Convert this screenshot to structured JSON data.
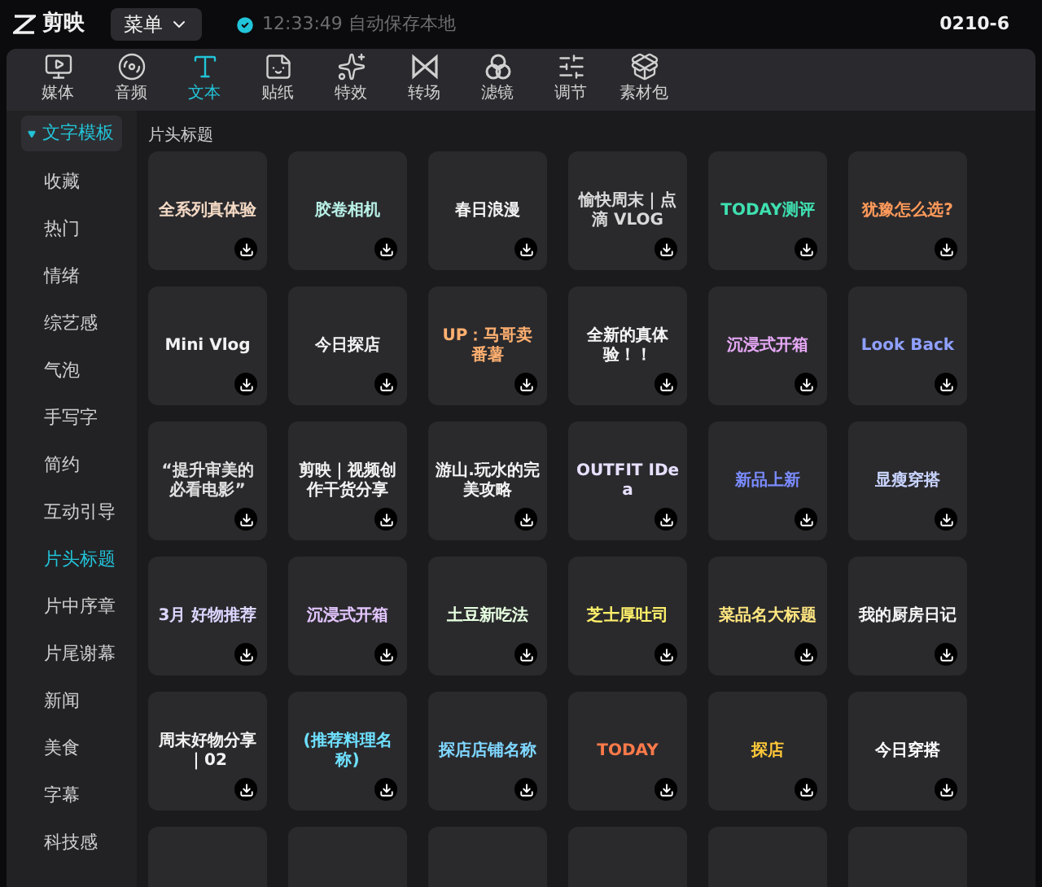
{
  "app": {
    "logo": "剪映",
    "menu": "菜单",
    "save_status": "12:33:49 自动保存本地",
    "project": "0210-6"
  },
  "tabs": [
    {
      "kind": "media",
      "label": "媒体",
      "selected": false
    },
    {
      "kind": "audio",
      "label": "音频",
      "selected": false
    },
    {
      "kind": "text",
      "label": "文本",
      "selected": true
    },
    {
      "kind": "sticker",
      "label": "贴纸",
      "selected": false
    },
    {
      "kind": "effect",
      "label": "特效",
      "selected": false
    },
    {
      "kind": "transition",
      "label": "转场",
      "selected": false
    },
    {
      "kind": "filter",
      "label": "滤镜",
      "selected": false
    },
    {
      "kind": "adjust",
      "label": "调节",
      "selected": false
    },
    {
      "kind": "package",
      "label": "素材包",
      "selected": false
    }
  ],
  "sidebar": {
    "header": "文字模板",
    "items": [
      {
        "label": "收藏",
        "selected": false
      },
      {
        "label": "热门",
        "selected": false
      },
      {
        "label": "情绪",
        "selected": false
      },
      {
        "label": "综艺感",
        "selected": false
      },
      {
        "label": "气泡",
        "selected": false
      },
      {
        "label": "手写字",
        "selected": false
      },
      {
        "label": "简约",
        "selected": false
      },
      {
        "label": "互动引导",
        "selected": false
      },
      {
        "label": "片头标题",
        "selected": true
      },
      {
        "label": "片中序章",
        "selected": false
      },
      {
        "label": "片尾谢幕",
        "selected": false
      },
      {
        "label": "新闻",
        "selected": false
      },
      {
        "label": "美食",
        "selected": false
      },
      {
        "label": "字幕",
        "selected": false
      },
      {
        "label": "科技感",
        "selected": false
      }
    ]
  },
  "section_title": "片头标题",
  "templates": [
    {
      "text": "全系列真体验",
      "color": "#f3d9c4"
    },
    {
      "text": "胶卷相机",
      "color": "#b8f0e6"
    },
    {
      "text": "春日浪漫",
      "color": "#f2f2f2"
    },
    {
      "text": "愉快周末｜点滴 VLOG",
      "color": "#d9d9d9"
    },
    {
      "text": "TODAY测评",
      "color": "#3fe0b0"
    },
    {
      "text": "犹豫怎么选?",
      "color": "#ff9a5a"
    },
    {
      "text": "Mini Vlog",
      "color": "#f2f2f2"
    },
    {
      "text": "今日探店",
      "color": "#f2f2f2"
    },
    {
      "text": "UP：马哥卖番薯",
      "color": "#ffb070"
    },
    {
      "text": "全新的真体验！！",
      "color": "#f5f5f5"
    },
    {
      "text": "沉浸式开箱",
      "color": "#e6a8f5"
    },
    {
      "text": "Look Back",
      "color": "#8fa0ff"
    },
    {
      "text": "“提升审美的必看电影”",
      "color": "#e0e0e0"
    },
    {
      "text": "剪映｜视频创作干货分享",
      "color": "#f2f2f2"
    },
    {
      "text": "游山.玩水的完美攻略",
      "color": "#f2f2f2"
    },
    {
      "text": "OUTFIT IDea",
      "color": "#e8e0ff"
    },
    {
      "text": "新品上新",
      "color": "#7a8cff"
    },
    {
      "text": "显瘦穿搭",
      "color": "#c9d4ff"
    },
    {
      "text": "3月 好物推荐",
      "color": "#dcd6ff"
    },
    {
      "text": "沉浸式开箱",
      "color": "#e3c6ff"
    },
    {
      "text": "土豆新吃法",
      "color": "#e6ffe0"
    },
    {
      "text": "芝士厚吐司",
      "color": "#fff06a"
    },
    {
      "text": "菜品名大标题",
      "color": "#ffe680"
    },
    {
      "text": "我的厨房日记",
      "color": "#f2f2f2"
    },
    {
      "text": "周末好物分享｜02",
      "color": "#f2f2f2"
    },
    {
      "text": "(推荐料理名称)",
      "color": "#6ee0ff"
    },
    {
      "text": "探店店铺名称",
      "color": "#7fd6ff"
    },
    {
      "text": "TODAY",
      "color": "#ff7a4a"
    },
    {
      "text": "探店",
      "color": "#ffc83a"
    },
    {
      "text": "今日穿搭",
      "color": "#ffffff"
    }
  ]
}
